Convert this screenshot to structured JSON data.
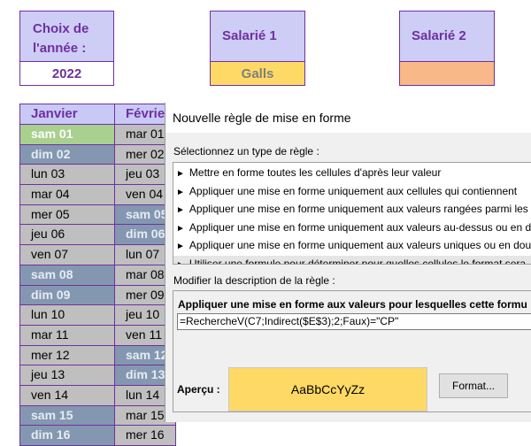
{
  "header": {
    "year_label": "Choix de l'année :",
    "year_value": "2022",
    "employee1_label": "Salarié 1",
    "employee1_value": "Galls",
    "employee2_label": "Salarié 2",
    "employee2_value": ""
  },
  "calendar": {
    "month1": "Janvier",
    "month2": "Févrie",
    "jan": [
      "sam 01",
      "dim 02",
      "lun 03",
      "mar 04",
      "mer 05",
      "jeu 06",
      "ven 07",
      "sam 08",
      "dim 09",
      "lun 10",
      "mar 11",
      "mer 12",
      "jeu 13",
      "ven 14",
      "sam 15",
      "dim 16"
    ],
    "feb": [
      "mar 01",
      "mer 02",
      "jeu 03",
      "ven 04",
      "sam 05",
      "dim 06",
      "lun 07",
      "mar 08",
      "mer 09",
      "jeu 10",
      "ven 11",
      "sam 12",
      "dim 13",
      "lun 14",
      "mar 15",
      "mer 16"
    ]
  },
  "dialog": {
    "title": "Nouvelle règle de mise en forme",
    "select_type_label": "Sélectionnez un type de règle :",
    "rule_types": [
      "Mettre en forme toutes les cellules d'après leur valeur",
      "Appliquer une mise en forme uniquement aux cellules qui contiennent",
      "Appliquer une mise en forme uniquement aux valeurs rangées parmi les",
      "Appliquer une mise en forme uniquement aux valeurs au-dessus ou en d",
      "Appliquer une mise en forme uniquement aux valeurs uniques ou en dou",
      "Utiliser une formule pour déterminer pour quelles cellules le format sera"
    ],
    "edit_desc_label": "Modifier la description de la règle :",
    "formula_label": "Appliquer une mise en forme aux valeurs pour lesquelles cette formu",
    "formula_value": "=RechercheV(C7;Indirect($E$3);2;Faux)=\"CP\"",
    "preview_label": "Aperçu :",
    "preview_text": "AaBbCcYyZz",
    "format_button": "Format..."
  },
  "colors": {
    "accent": "#7030a0",
    "header_fill": "#cdcdf6",
    "employee1_fill": "#ffd966",
    "employee2_fill": "#f8b888",
    "weekend_fill": "#8497b0",
    "weekday_fill": "#bfbfbf",
    "highlight_fill": "#a9d08e",
    "preview_fill": "#ffd966"
  }
}
